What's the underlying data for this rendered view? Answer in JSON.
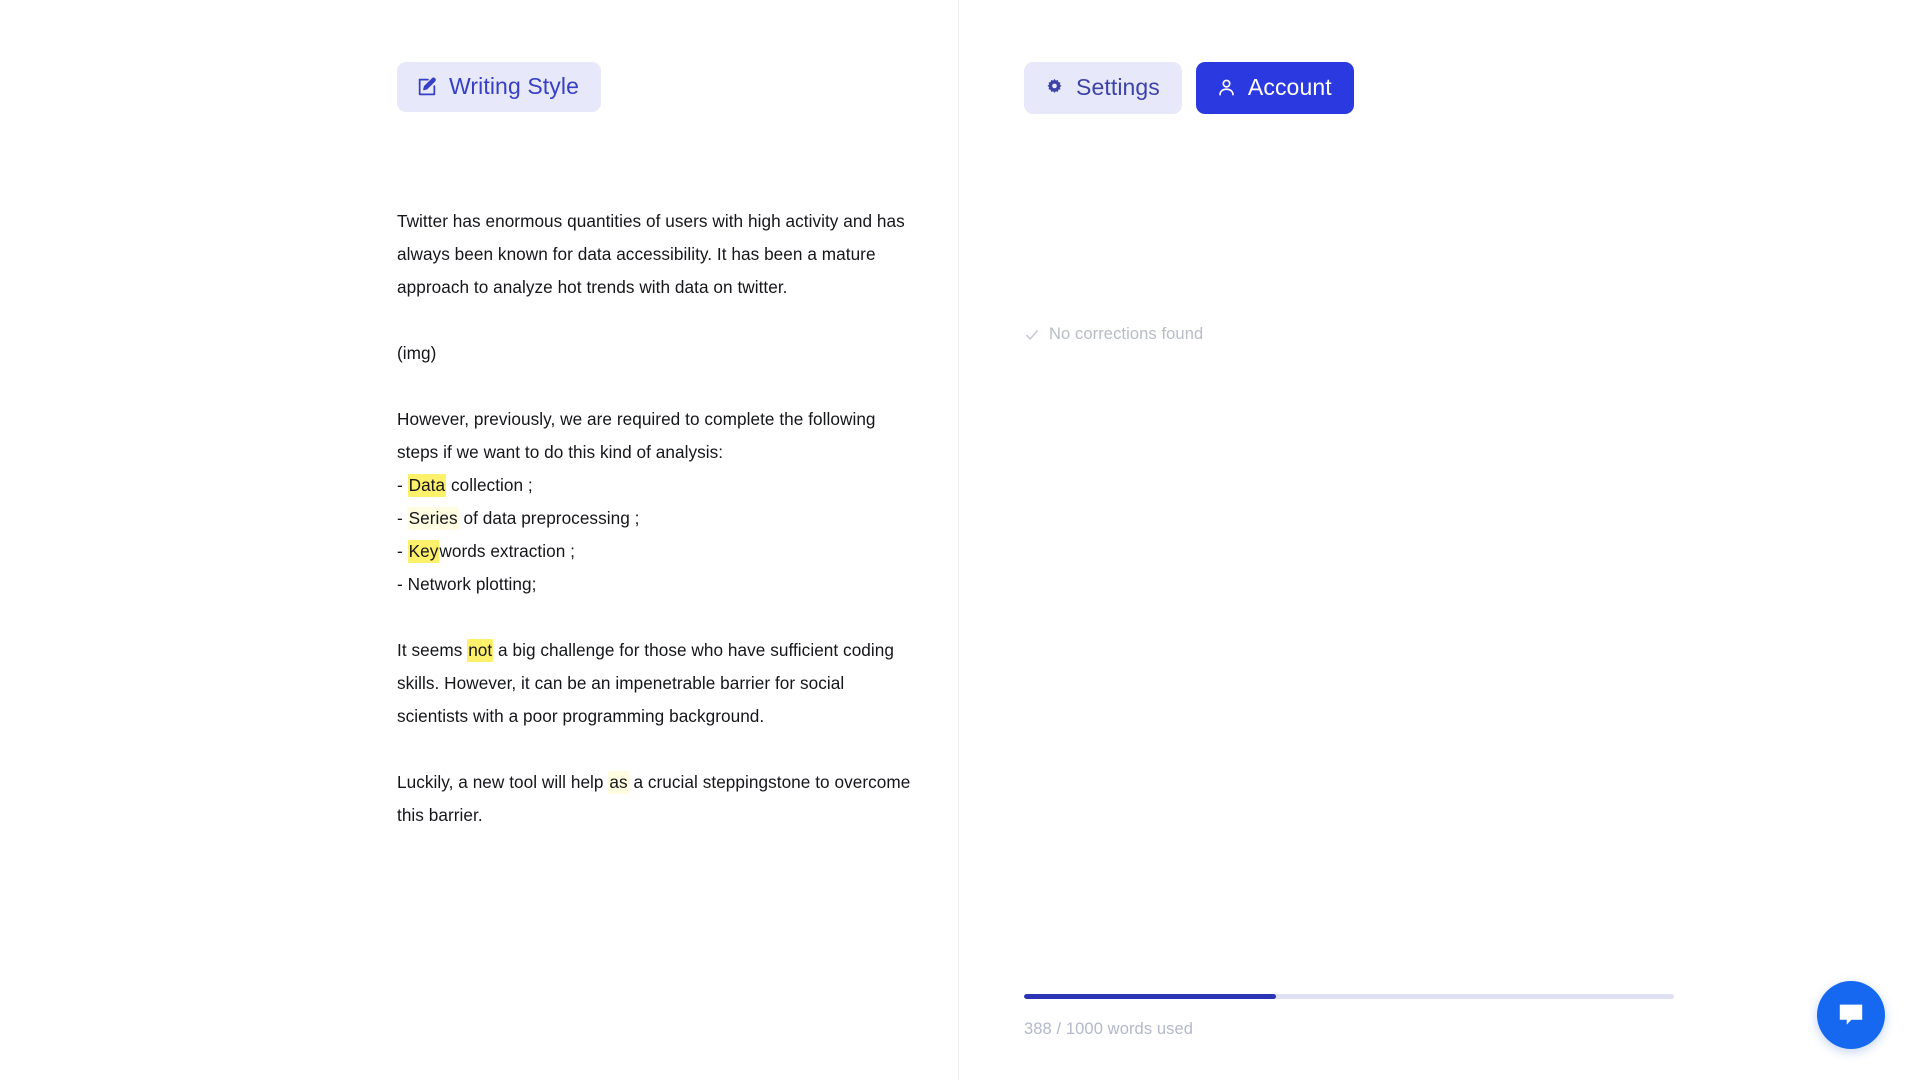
{
  "editor": {
    "style_button": {
      "label": "Writing Style",
      "icon": "edit-pen-icon"
    },
    "document": {
      "paragraph_1": "Twitter has enormous quantities of users with high activity and has always been known for data accessibility. It has been a mature approach to analyze hot trends with data on twitter.",
      "image_placeholder": "(img)",
      "paragraph_2_intro": "However, previously, we are required to complete the following steps if we want to do this kind of analysis:",
      "list": [
        {
          "prefix": "- ",
          "highlight": "Data",
          "highlight_style": "strong",
          "rest": " collection ;"
        },
        {
          "prefix": "- ",
          "highlight": "Series",
          "highlight_style": "faint",
          "rest": " of data preprocessing ;"
        },
        {
          "prefix": "- ",
          "highlight": "Key",
          "highlight_style": "strong",
          "rest": "words extraction ;"
        },
        {
          "prefix": "- ",
          "highlight": "",
          "highlight_style": "none",
          "rest": "Network plotting;"
        }
      ],
      "paragraph_3_before": "It seems ",
      "paragraph_3_highlight": "not",
      "paragraph_3_after": " a big challenge for those who have sufficient coding skills. However, it can be an impenetrable barrier for social scientists with a poor programming background.",
      "paragraph_4_before": "Luckily, a new tool will help ",
      "paragraph_4_highlight": "as",
      "paragraph_4_after": " a crucial steppingstone to overcome this barrier."
    }
  },
  "sidebar": {
    "buttons": [
      {
        "label": "Settings",
        "icon": "gear-icon",
        "variant": "secondary"
      },
      {
        "label": "Account",
        "icon": "user-icon",
        "variant": "primary"
      }
    ],
    "corrections": {
      "icon": "check-icon",
      "message": "No corrections found"
    },
    "usage": {
      "words_used": 388,
      "words_limit": 1000,
      "label": "388 / 1000 words used",
      "percent": 38.8
    }
  },
  "chat": {
    "icon": "chat-bubble-icon",
    "label": "Open chat"
  },
  "colors": {
    "accent_blue": "#2b3ae0",
    "chip_bg": "#e7e9fb",
    "chip_text": "#3740c4",
    "highlight_yellow": "#fdf06a",
    "progress_fill": "#2b34b5",
    "progress_track": "#dfe1f2",
    "muted_text": "#b3b8cb",
    "body_text": "#15161a",
    "chat_fab": "#1668f0"
  }
}
